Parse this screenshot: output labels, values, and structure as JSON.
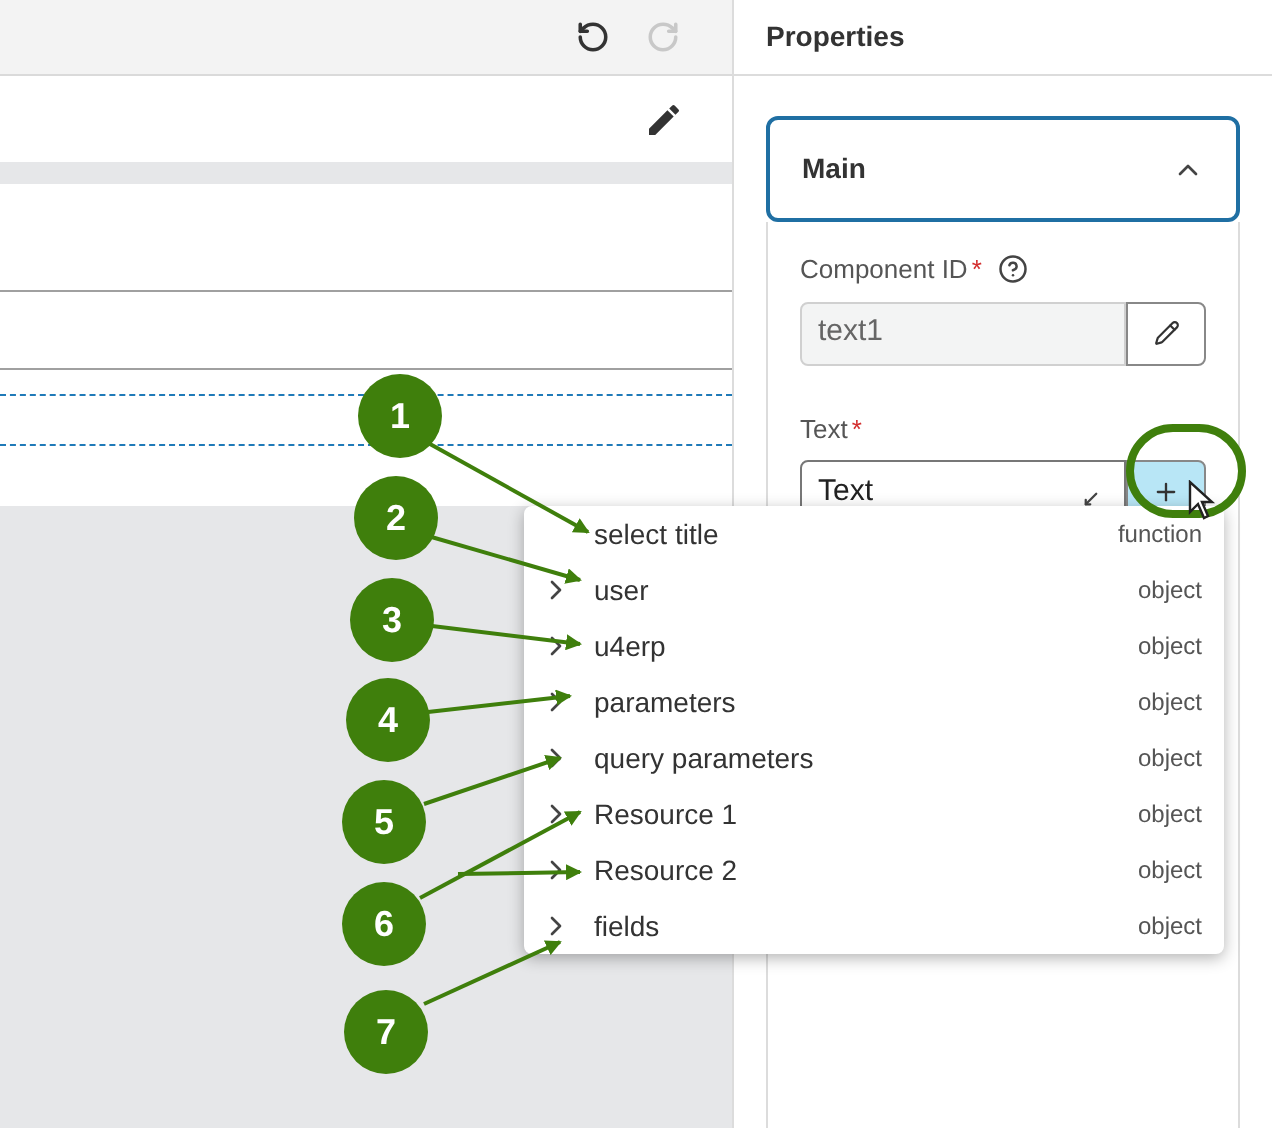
{
  "toolbar": {
    "undo": {
      "disabled": false
    },
    "redo": {
      "disabled": true
    }
  },
  "properties": {
    "title": "Properties",
    "section": {
      "title": "Main",
      "expanded": true
    },
    "fields": [
      {
        "kind": "id",
        "label": "Component ID",
        "required_mark": "*",
        "value": "text1"
      },
      {
        "kind": "expression",
        "label": "Text",
        "required_mark": "*",
        "value": "Text"
      }
    ]
  },
  "dropdown": {
    "items": [
      {
        "label": "select title",
        "type": "function",
        "expandable": false
      },
      {
        "label": "user",
        "type": "object",
        "expandable": true
      },
      {
        "label": "u4erp",
        "type": "object",
        "expandable": true
      },
      {
        "label": "parameters",
        "type": "object",
        "expandable": true
      },
      {
        "label": "query parameters",
        "type": "object",
        "expandable": true
      },
      {
        "label": "Resource 1",
        "type": "object",
        "expandable": true
      },
      {
        "label": "Resource 2",
        "type": "object",
        "expandable": true
      },
      {
        "label": "fields",
        "type": "object",
        "expandable": true
      }
    ]
  },
  "annotations": [
    {
      "number": "1"
    },
    {
      "number": "2"
    },
    {
      "number": "3"
    },
    {
      "number": "4"
    },
    {
      "number": "5"
    },
    {
      "number": "6"
    },
    {
      "number": "7"
    }
  ]
}
